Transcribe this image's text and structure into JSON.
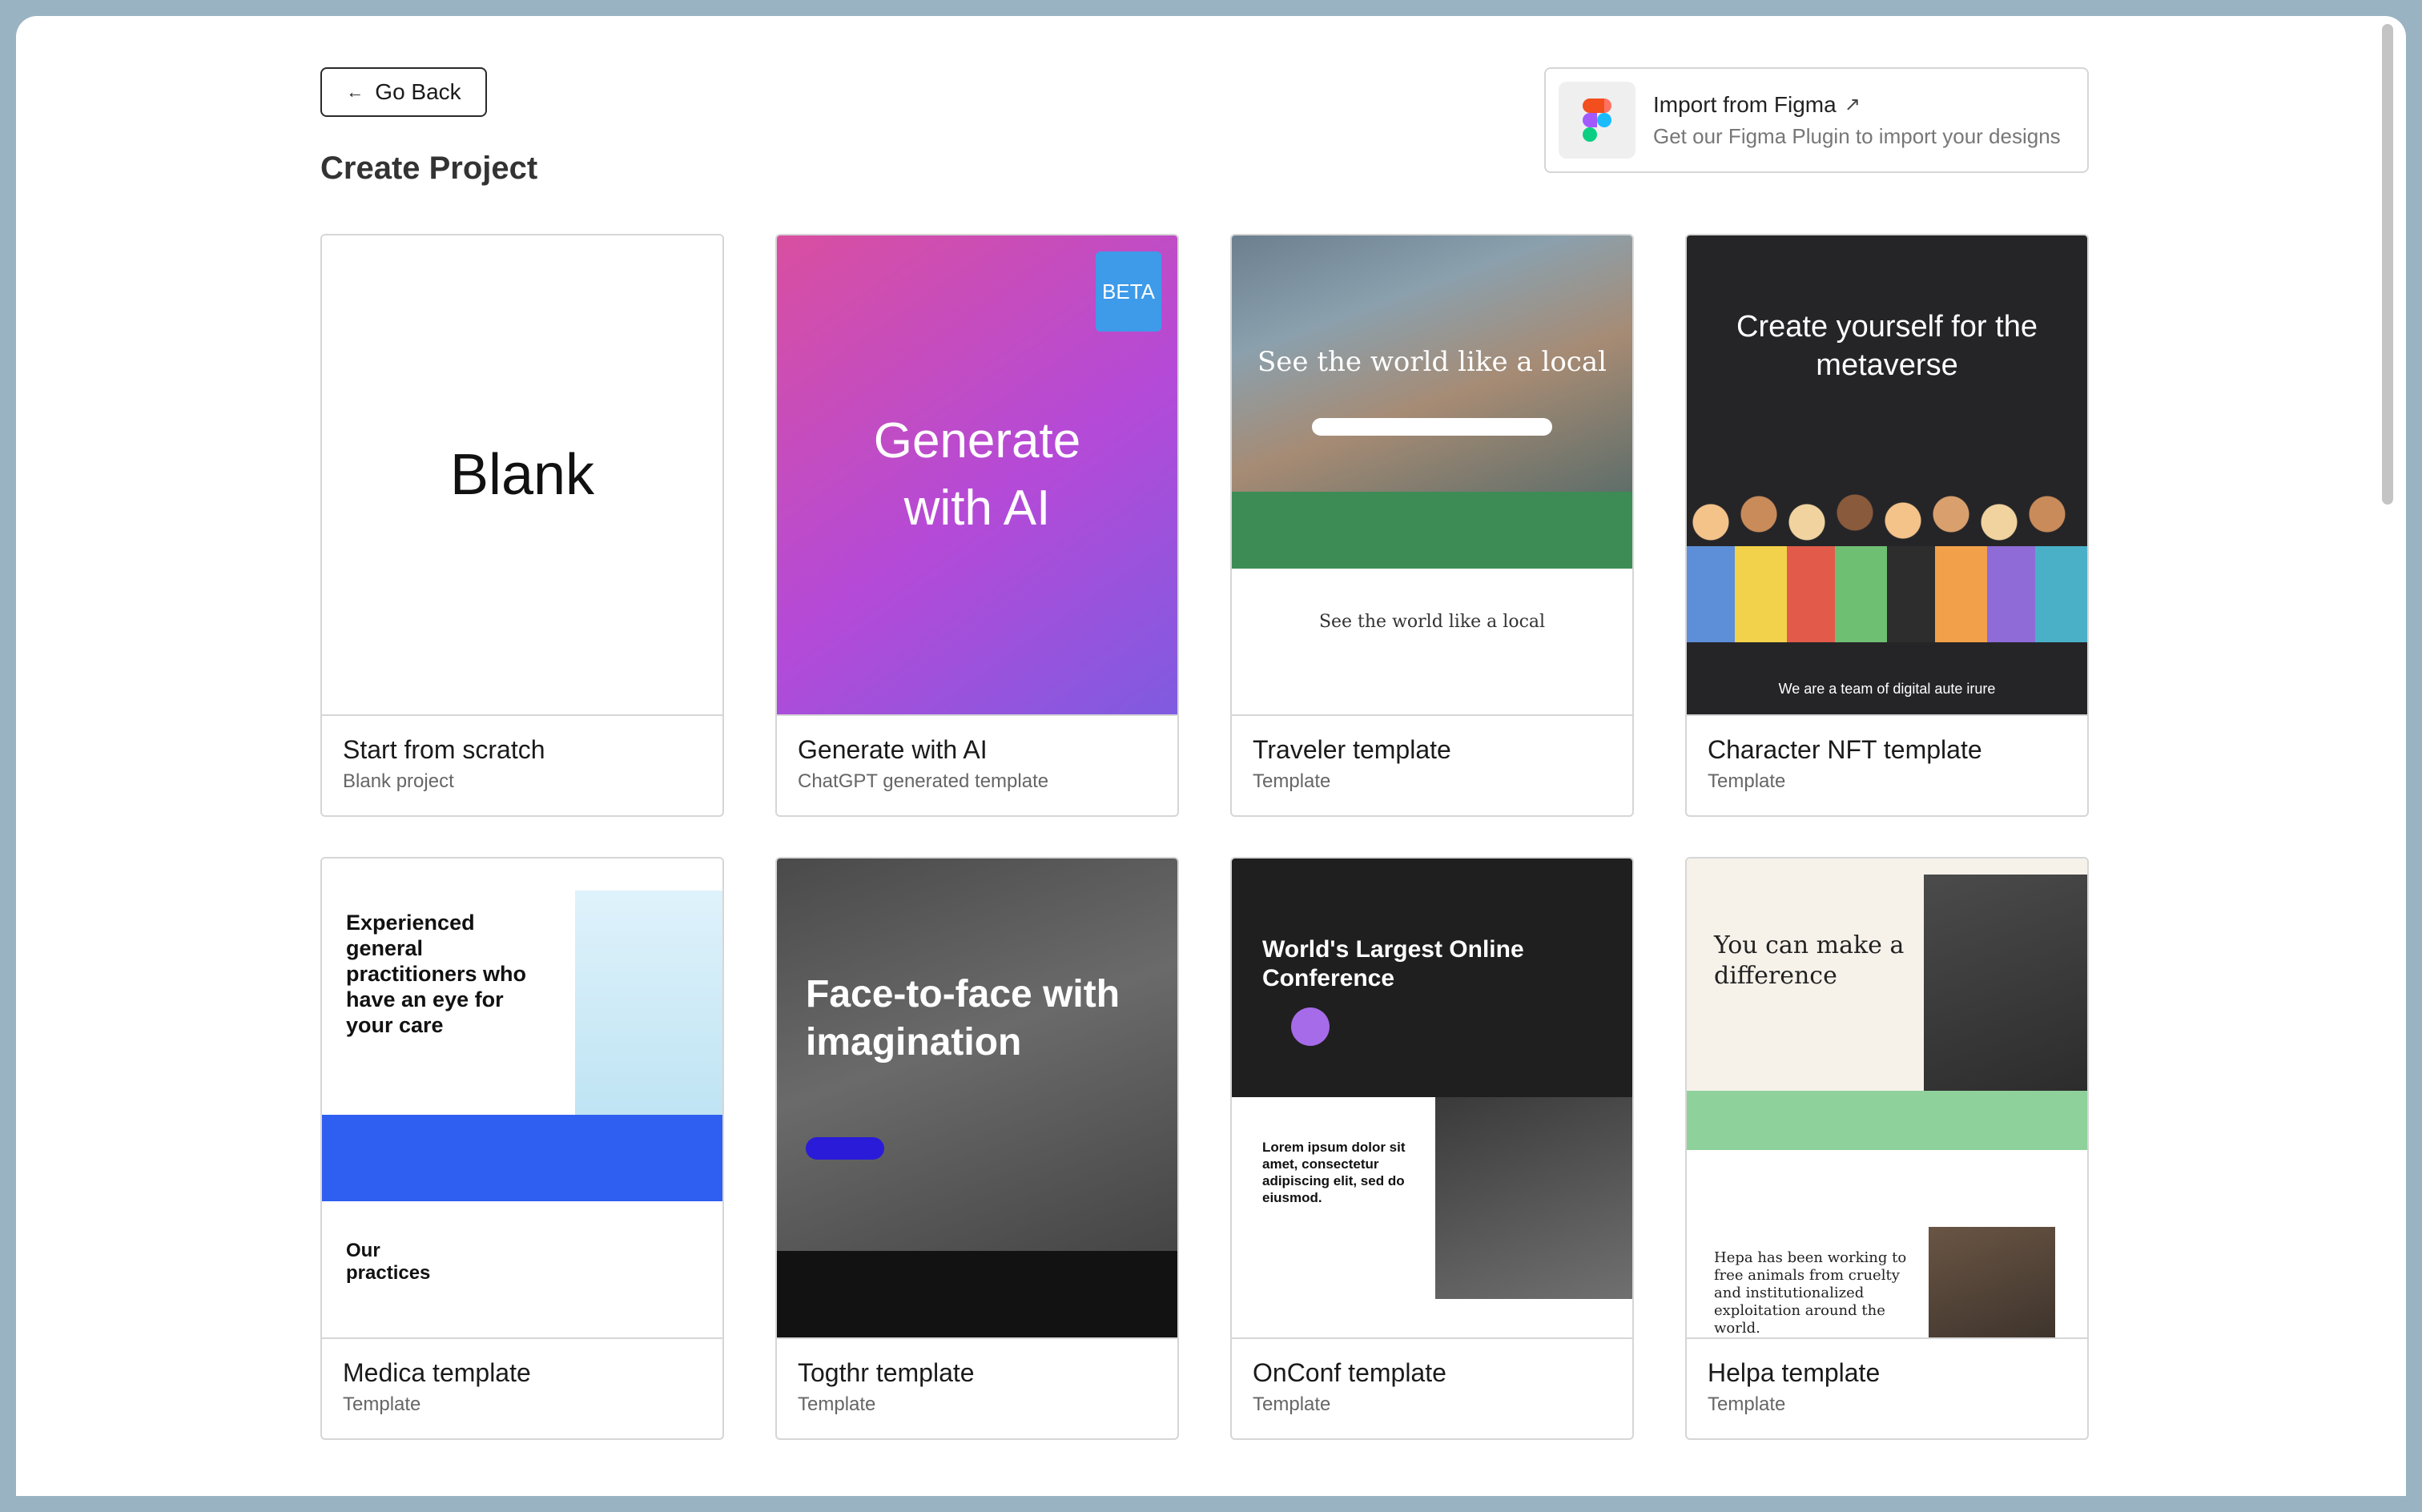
{
  "header": {
    "back_label": "Go Back",
    "title": "Create Project"
  },
  "figma": {
    "title": "Import from Figma",
    "subtitle": "Get our Figma Plugin to import your designs"
  },
  "cards": [
    {
      "name": "Start from scratch",
      "sub": "Blank project",
      "thumb_text": "Blank"
    },
    {
      "name": "Generate with AI",
      "sub": "ChatGPT generated template",
      "thumb_text": "Generate with AI",
      "badge": "BETA"
    },
    {
      "name": "Traveler template",
      "sub": "Template",
      "thumb_text": "See the world like a local",
      "thumb_text2": "See the world like a local"
    },
    {
      "name": "Character NFT template",
      "sub": "Template",
      "thumb_text": "Create yourself for the metaverse",
      "thumb_text2": "We are a team of digital aute irure"
    },
    {
      "name": "Medica template",
      "sub": "Template",
      "thumb_text": "Experienced general practitioners who have an eye for your care",
      "thumb_text2": "Our practices"
    },
    {
      "name": "Togthr template",
      "sub": "Template",
      "thumb_text": "Face-to-face with imagination"
    },
    {
      "name": "OnConf template",
      "sub": "Template",
      "thumb_text": "World's Largest Online Conference",
      "thumb_text2": "Lorem ipsum dolor sit amet, consectetur adipiscing elit, sed do eiusmod."
    },
    {
      "name": "Helpa template",
      "sub": "Template",
      "thumb_text": "You can make a difference",
      "thumb_text2": "Hepa has been working to free animals from cruelty and institutionalized exploitation around the world."
    }
  ],
  "colors": {
    "accent_beta": "#3d9bea",
    "traveler_green": "#3d8c55",
    "medica_blue": "#2f5ff0",
    "helpa_green": "#8fd19a"
  },
  "icons": {
    "back": "arrow-left-icon",
    "figma": "figma-logo-icon",
    "external": "external-link-icon"
  }
}
